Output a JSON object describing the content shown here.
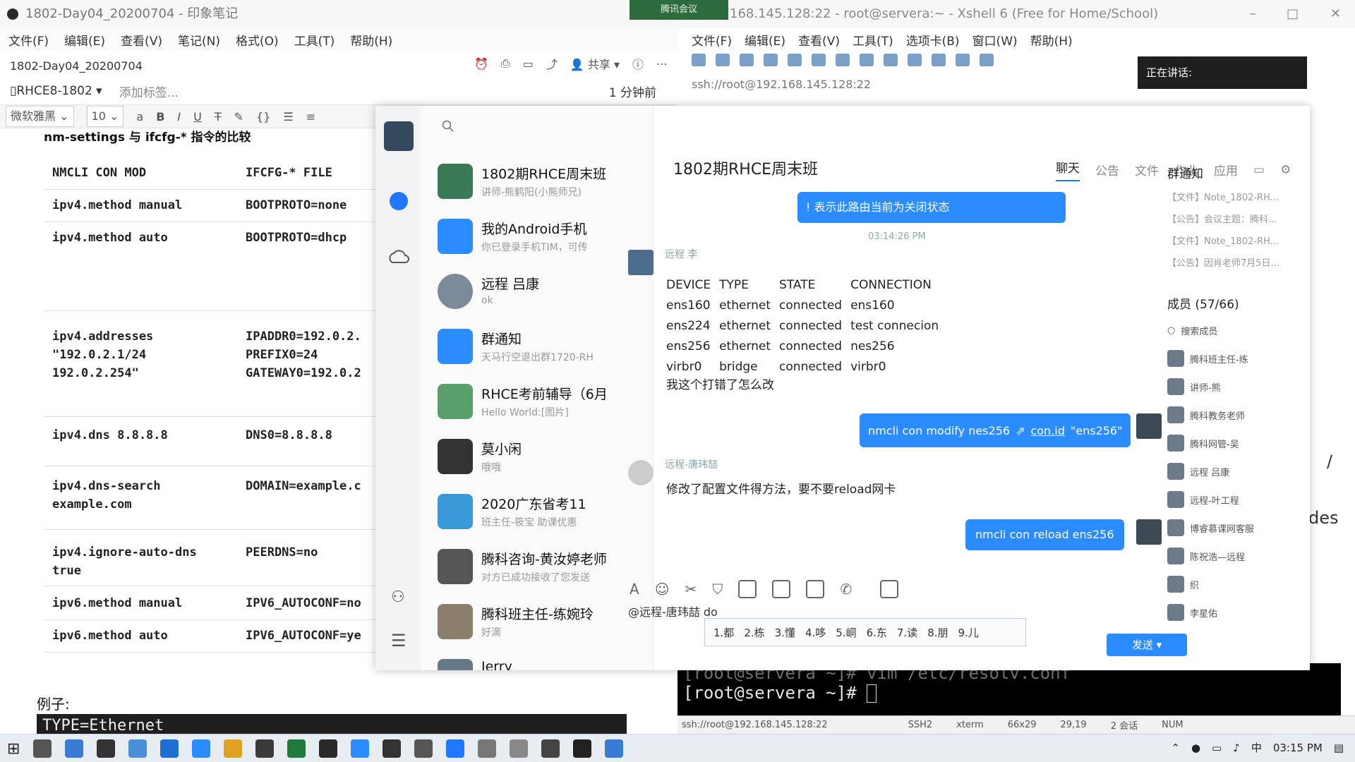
{
  "evernote": {
    "title": "1802-Day04_20200704 - 印象笔记",
    "menu": [
      "文件(F)",
      "编辑(E)",
      "查看(V)",
      "笔记(N)",
      "格式(O)",
      "工具(T)",
      "帮助(H)"
    ],
    "doc_title": "1802-Day04_20200704",
    "share_label": "共享",
    "notebook": "RHCE8-1802",
    "add_tag": "添加标签...",
    "updated": "1 分钟前",
    "font": "微软雅黑",
    "font_size": "10",
    "heading": "nm-settings 与 ifcfg-* 指令的比较",
    "col_a": "NMCLI CON MOD",
    "col_b": "IFCFG-* FILE",
    "rows": [
      {
        "a": "ipv4.method manual",
        "b": "BOOTPROTO=none"
      },
      {
        "a": "ipv4.method auto",
        "b": "BOOTPROTO=dhcp"
      },
      {
        "a": "ipv4.addresses\n\"192.0.2.1/24\n192.0.2.254\"",
        "b": "IPADDR0=192.0.2.\nPREFIX0=24\nGATEWAY0=192.0.2"
      },
      {
        "a": "ipv4.dns 8.8.8.8",
        "b": "DNS0=8.8.8.8"
      },
      {
        "a": "ipv4.dns-search\nexample.com",
        "b": "DOMAIN=example.c"
      },
      {
        "a": "ipv4.ignore-auto-dns\ntrue",
        "b": "PEERDNS=no"
      },
      {
        "a": "ipv6.method manual",
        "b": "IPV6_AUTOCONF=no"
      },
      {
        "a": "ipv6.method auto",
        "b": "IPV6_AUTOCONF=ye"
      }
    ],
    "example_label": "例子:",
    "example_code": "TYPE=Ethernet"
  },
  "xshell": {
    "title": "168.145.128:22 - root@servera:~ - Xshell 6 (Free for Home/School)",
    "meeting_badge": "腾讯会议",
    "menu": [
      "文件(F)",
      "编辑(E)",
      "查看(V)",
      "工具(T)",
      "选项卡(B)",
      "窗口(W)",
      "帮助(H)"
    ],
    "address": "ssh://root@192.168.145.128:22",
    "speaking": "正在讲话:",
    "term_line1": "[root@servera ~]# vim /etc/resolv.conf",
    "term_line2": "[root@servera ~]# ",
    "right_frag1": "/",
    "right_frag2": "des",
    "status": [
      "ssh://root@192.168.145.128:22",
      "SSH2",
      "xterm",
      "66x29",
      "29,19",
      "2 会话",
      "NUM"
    ]
  },
  "tim": {
    "conversations": [
      {
        "name": "1802期RHCE周末班",
        "preview": "讲师-熊鹤阳(小熊师兄)",
        "color": "#3b7a57"
      },
      {
        "name": "我的Android手机",
        "preview": "你已登录手机TIM，可传",
        "color": "#2b8cff"
      },
      {
        "name": "远程 吕康",
        "preview": "ok",
        "color": "#7a8a99"
      },
      {
        "name": "群通知",
        "preview": "天马行空退出群1720-RH",
        "color": "#2b8cff"
      },
      {
        "name": "RHCE考前辅导（6月",
        "preview": "Hello World:[图片]",
        "color": "#5aa06c"
      },
      {
        "name": "莫小闲",
        "preview": "哦哦",
        "color": "#333333"
      },
      {
        "name": "2020广东省考11",
        "preview": "班主任-筱宝 助课优惠",
        "color": "#3a9ad9"
      },
      {
        "name": "腾科咨询-黄汝婷老师",
        "preview": "对方已成功接收了您发送",
        "color": "#555555"
      },
      {
        "name": "腾科班主任-练婉玲",
        "preview": "好滴",
        "color": "#8a7f6b"
      },
      {
        "name": "Jerry",
        "preview": "",
        "color": "#667788"
      }
    ],
    "chat_title": "1802期RHCE周末班",
    "tabs": [
      "聊天",
      "公告",
      "文件",
      "作业",
      "应用"
    ],
    "msg_top": "! 表示此路由当前为关闭状态",
    "time1": "03:14:26 PM",
    "sender1": "远程 李",
    "table_head": [
      "DEVICE",
      "TYPE",
      "STATE",
      "CONNECTION"
    ],
    "table_rows": [
      [
        "ens160",
        "ethernet",
        "connected",
        "ens160"
      ],
      [
        "ens224",
        "ethernet",
        "connected",
        "test connecion"
      ],
      [
        "ens256",
        "ethernet",
        "connected",
        "nes256"
      ],
      [
        "virbr0",
        "bridge",
        "connected",
        "virbr0"
      ]
    ],
    "question": "我这个打错了怎么改",
    "reply1_pre": "nmcli con modify nes256",
    "reply1_link": "con.id",
    "reply1_post": "\"ens256\"",
    "sender2": "远程-唐玮喆",
    "msg2": "修改了配置文件得方法，要不要reload网卡",
    "reply2": "nmcli con reload ens256",
    "input_text": "@远程-唐玮喆 do",
    "ime_candidates": [
      "1.都",
      "2.栋",
      "3.懂",
      "4.哆",
      "5.峒",
      "6.东",
      "7.读",
      "8.朋",
      "9.儿"
    ],
    "send": "发送",
    "side_title": "群通知",
    "side_items": [
      "【文件】Note_1802-RH...",
      "【公告】会议主题：腾科...",
      "【文件】Note_1802-RH...",
      "【公告】因肖老师7月5日..."
    ],
    "members_title": "成员 (57/66)",
    "member_search": "搜索成员",
    "members": [
      "腾科班主任-练",
      "讲师-熊",
      "腾科教务老师",
      "腾科网管-吴",
      "远程 吕康",
      "远程-叶工程",
      "博睿慕课网客服",
      "陈祝浩—远程",
      "织",
      "李星佑"
    ]
  },
  "taskbar": {
    "time": "03:15 PM"
  }
}
